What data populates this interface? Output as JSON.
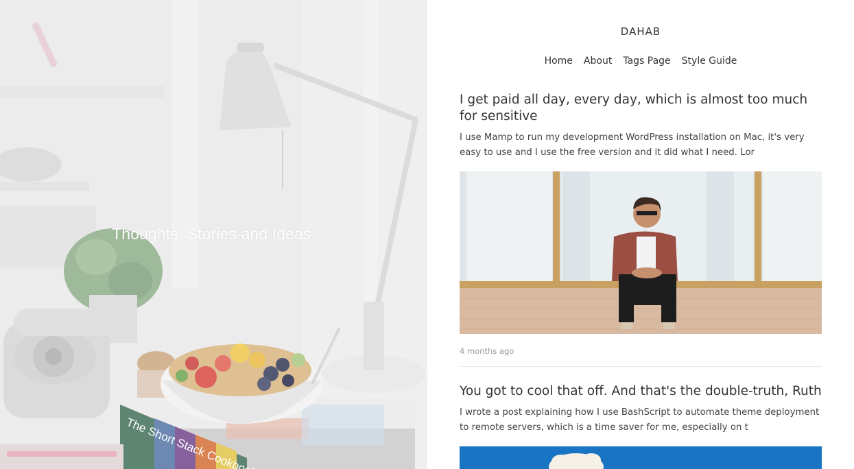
{
  "hero": {
    "tagline": "Thoughts, Stories and Ideas.",
    "book_spine_text": "The Short Stack Cookbook"
  },
  "site": {
    "title": "DAHAB",
    "nav": [
      "Home",
      "About",
      "Tags Page",
      "Style Guide"
    ]
  },
  "posts": [
    {
      "title": "I get paid all day, every day, which is almost too much for sensitive",
      "excerpt": "I use Mamp to run my development WordPress installation on Mac, it's very easy to use and I use the free version and it did what I need. Lor",
      "meta": "4 months ago"
    },
    {
      "title": "You got to cool that off. And that's the double-truth, Ruth",
      "excerpt": "I wrote a post explaining how I use BashScript to automate theme deployment to remote servers, which is a time saver for me, especially on t"
    }
  ],
  "colors": {
    "text": "#333333",
    "muted": "#999999",
    "divider": "#eaeaea",
    "post2_image_blue": "#1c78c8"
  }
}
